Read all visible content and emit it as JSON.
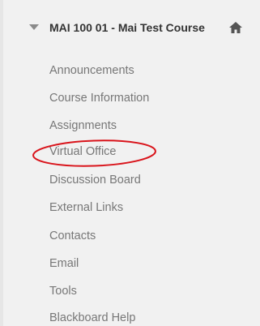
{
  "course": {
    "title": "MAI 100 01 - Mai Test Course",
    "collapse_icon": "triangle-down-icon",
    "home_icon": "home-icon"
  },
  "menu": {
    "items": [
      {
        "label": "Announcements"
      },
      {
        "label": "Course Information"
      },
      {
        "label": "Assignments"
      },
      {
        "label": "Virtual Office"
      },
      {
        "label": "Discussion Board"
      },
      {
        "label": "External Links"
      },
      {
        "label": "Contacts"
      },
      {
        "label": "Email"
      },
      {
        "label": "Tools"
      },
      {
        "label": "Blackboard Help"
      }
    ],
    "highlighted_item": "Virtual Office"
  },
  "colors": {
    "panel_bg": "#f1f1f1",
    "title_text": "#333333",
    "item_text": "#777777",
    "highlight": "#d9141b"
  }
}
